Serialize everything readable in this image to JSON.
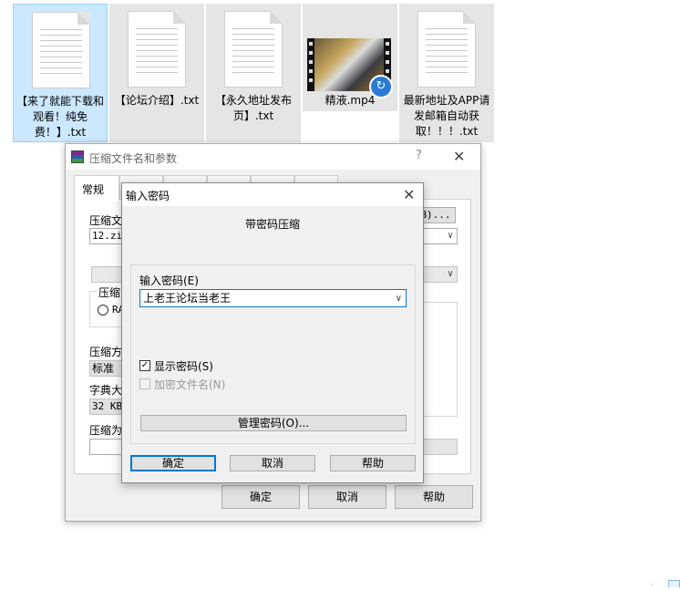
{
  "desktop": {
    "files": [
      {
        "name": "【来了就能下载和观看！纯免费！】.txt",
        "type": "txt",
        "selected": true
      },
      {
        "name": "【论坛介绍】.txt",
        "type": "txt",
        "selected": false
      },
      {
        "name": "【永久地址发布页】.txt",
        "type": "txt",
        "selected": false
      },
      {
        "name": "精液.mp4",
        "type": "mp4",
        "selected": false
      },
      {
        "name": "最新地址及APP请发邮箱自动获取！！！.txt",
        "type": "txt",
        "selected": false
      }
    ],
    "mp4_badge_icon": "share-arrow-icon"
  },
  "archive_dialog": {
    "title": "压缩文件名和参数",
    "help_glyph": "?",
    "close_glyph": "✕",
    "tabs": [
      "常规",
      "",
      "",
      "",
      "",
      ""
    ],
    "archive_name_label": "压缩文",
    "archive_name_value": "12.zi",
    "browse_button_fragment": "B)...",
    "format_group_label": "压缩",
    "format_option_fragment": "RA",
    "method_label": "压缩方",
    "method_value": "标准",
    "dict_label": "字典大",
    "dict_value": "32 KB",
    "split_label": "压缩为",
    "ok_label": "确定",
    "cancel_label": "取消",
    "help_label": "帮助"
  },
  "password_dialog": {
    "title": "输入密码",
    "close_glyph": "✕",
    "heading": "带密码压缩",
    "password_label": "输入密码(E)",
    "password_value": "上老王论坛当老王",
    "show_password_label": "显示密码(S)",
    "show_password_checked": true,
    "encrypt_names_label": "加密文件名(N)",
    "encrypt_names_checked": false,
    "manage_passwords_label": "管理密码(O)...",
    "ok_label": "确定",
    "cancel_label": "取消",
    "help_label": "帮助"
  },
  "colors": {
    "selection_bg": "#cce8ff",
    "accent": "#0078d7",
    "dialog_bg": "#f0f0f0"
  }
}
